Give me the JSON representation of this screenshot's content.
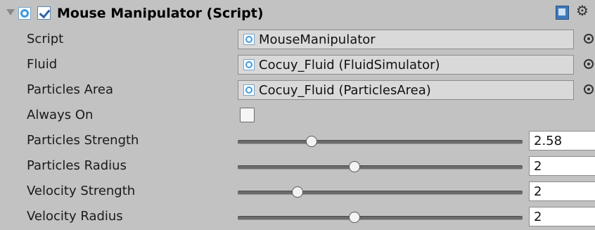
{
  "component": {
    "title": "Mouse Manipulator (Script)",
    "enabled": true
  },
  "fields": [
    {
      "label": "Script",
      "type": "object",
      "value": "MouseManipulator"
    },
    {
      "label": "Fluid",
      "type": "object",
      "value": "Cocuy_Fluid (FluidSimulator)"
    },
    {
      "label": "Particles Area",
      "type": "object",
      "value": "Cocuy_Fluid (ParticlesArea)"
    },
    {
      "label": "Always On",
      "type": "toggle",
      "checked": false
    },
    {
      "label": "Particles Strength",
      "type": "slider",
      "value": "2.58",
      "fraction": 0.26
    },
    {
      "label": "Particles Radius",
      "type": "slider",
      "value": "2",
      "fraction": 0.41
    },
    {
      "label": "Velocity Strength",
      "type": "slider",
      "value": "2",
      "fraction": 0.21
    },
    {
      "label": "Velocity Radius",
      "type": "slider",
      "value": "2",
      "fraction": 0.41
    }
  ],
  "icons": {
    "foldout": "foldout-arrow-icon",
    "script": "csharp-script-icon",
    "help": "help-book-icon",
    "settings": "gear-icon",
    "picker": "object-picker-icon"
  }
}
